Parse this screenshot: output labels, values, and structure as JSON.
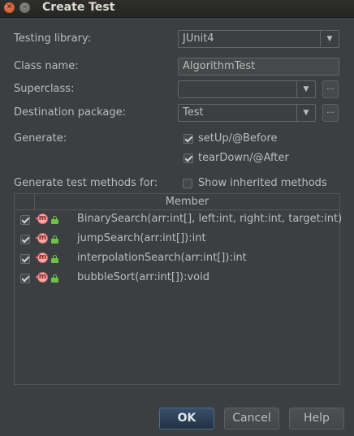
{
  "window": {
    "title": "Create Test",
    "close_glyph": "✕",
    "minimize_glyph": "–"
  },
  "form": {
    "testing_library_label": "Testing library:",
    "testing_library_value": "JUnit4",
    "class_name_label": "Class name:",
    "class_name_value": "AlgorithmTest",
    "superclass_label": "Superclass:",
    "superclass_value": "",
    "destination_label": "Destination package:",
    "destination_value": "Test",
    "browse_label": "...",
    "generate_label": "Generate:",
    "setup_label": "setUp/@Before",
    "setup_checked": true,
    "teardown_label": "tearDown/@After",
    "teardown_checked": true,
    "methods_for_label": "Generate test methods for:",
    "show_inherited_label": "Show inherited methods",
    "show_inherited_checked": false
  },
  "table": {
    "header": "Member",
    "icon": "method-icon",
    "method_glyph": "m",
    "rows": [
      {
        "signature": "BinarySearch(arr:int[], left:int, right:int, target:int)",
        "checked": true
      },
      {
        "signature": "jumpSearch(arr:int[]):int",
        "checked": true
      },
      {
        "signature": "interpolationSearch(arr:int[]):int",
        "checked": true
      },
      {
        "signature": "bubbleSort(arr:int[]):void",
        "checked": true
      }
    ]
  },
  "buttons": {
    "ok": "OK",
    "cancel": "Cancel",
    "help": "Help"
  },
  "colors": {
    "background": "#3c3f41",
    "text": "#bbbbbb",
    "ok_button": "#2c3e55",
    "method_icon": "#f4a9a9",
    "lock_icon": "#6ec24a"
  }
}
